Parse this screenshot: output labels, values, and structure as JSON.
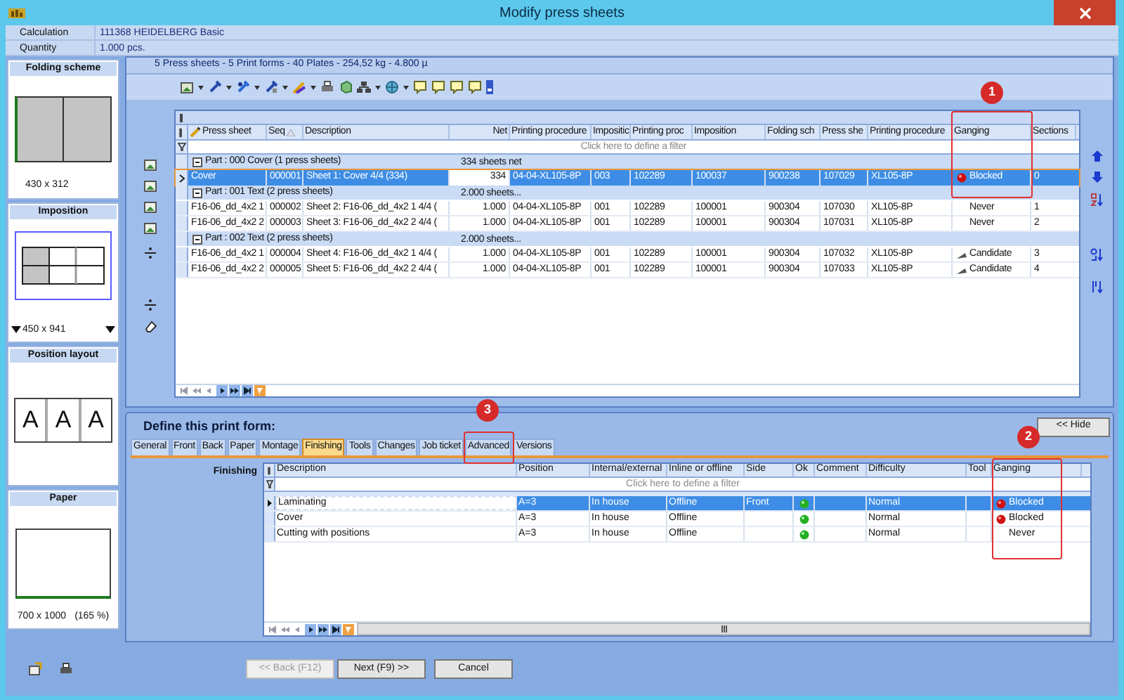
{
  "window": {
    "title": "Modify press sheets"
  },
  "header": [
    {
      "label": "Calculation",
      "value": "111368 HEIDELBERG Basic"
    },
    {
      "label": "Quantity",
      "value": "1.000 pcs."
    }
  ],
  "side_panels": [
    {
      "kind": "folding",
      "title": "Folding scheme",
      "caption": "430 x 312"
    },
    {
      "kind": "imposition",
      "title": "Imposition",
      "caption": "450 x 941"
    },
    {
      "kind": "positions",
      "title": "Position layout",
      "letters": [
        "A",
        "A",
        "A"
      ]
    },
    {
      "kind": "paper",
      "title": "Paper",
      "caption": "700 x 1000",
      "zoom": "(165 %)"
    }
  ],
  "summary": "5 Press sheets - 5 Print forms - 40 Plates - 254,52 kg - 4.800 µ",
  "press_sheets": {
    "columns": [
      "Press sheet",
      "Seq",
      "Description",
      "Net",
      "Printing procedure",
      "Impositic",
      "Printing proc",
      "Imposition",
      "Folding sch",
      "Press she",
      "Printing procedure",
      "Ganging",
      "Sections"
    ],
    "filter_placeholder": "Click here to define a filter",
    "groups": [
      {
        "title": "Part : 000 Cover (1 press sheets)",
        "total": "334 sheets net",
        "rows": [
          {
            "selected": true,
            "cells": [
              "Cover",
              "000001",
              "Sheet 1: Cover 4/4 (334)",
              "334",
              "04-04-XL105-8P",
              "003",
              "102289",
              "100037",
              "900238",
              "107029",
              "XL105-8P"
            ],
            "ganging": {
              "kind": "blocked",
              "label": "Blocked"
            },
            "sections": "0"
          }
        ]
      },
      {
        "title": "Part : 001 Text (2 press sheets)",
        "total": "2.000 sheets...",
        "rows": [
          {
            "selected": false,
            "cells": [
              "F16-06_dd_4x2 1",
              "000002",
              "Sheet 2: F16-06_dd_4x2 1 4/4 (",
              "1.000",
              "04-04-XL105-8P",
              "001",
              "102289",
              "100001",
              "900304",
              "107030",
              "XL105-8P"
            ],
            "ganging": {
              "kind": "never",
              "label": "Never"
            },
            "sections": "1"
          },
          {
            "selected": false,
            "cells": [
              "F16-06_dd_4x2 2",
              "000003",
              "Sheet 3: F16-06_dd_4x2 2 4/4 (",
              "1.000",
              "04-04-XL105-8P",
              "001",
              "102289",
              "100001",
              "900304",
              "107031",
              "XL105-8P"
            ],
            "ganging": {
              "kind": "never",
              "label": "Never"
            },
            "sections": "2"
          }
        ]
      },
      {
        "title": "Part : 002 Text (2 press sheets)",
        "total": "2.000 sheets...",
        "rows": [
          {
            "selected": false,
            "cells": [
              "F16-06_dd_4x2 1",
              "000004",
              "Sheet 4: F16-06_dd_4x2 1 4/4 (",
              "1.000",
              "04-04-XL105-8P",
              "001",
              "102289",
              "100001",
              "900304",
              "107032",
              "XL105-8P"
            ],
            "ganging": {
              "kind": "candidate",
              "label": "Candidate"
            },
            "sections": "3"
          },
          {
            "selected": false,
            "cells": [
              "F16-06_dd_4x2 2",
              "000005",
              "Sheet 5: F16-06_dd_4x2 2 4/4 (",
              "1.000",
              "04-04-XL105-8P",
              "001",
              "102289",
              "100001",
              "900304",
              "107033",
              "XL105-8P"
            ],
            "ganging": {
              "kind": "candidate",
              "label": "Candidate"
            },
            "sections": "4"
          }
        ]
      }
    ]
  },
  "print_form": {
    "title": "Define this print form:",
    "hide_button": "<< Hide",
    "tabs": [
      {
        "label": "General",
        "selected": false
      },
      {
        "label": "Front",
        "selected": false
      },
      {
        "label": "Back",
        "selected": false
      },
      {
        "label": "Paper",
        "selected": false
      },
      {
        "label": "Montage",
        "selected": false
      },
      {
        "label": "Finishing",
        "selected": true
      },
      {
        "label": "Tools",
        "selected": false
      },
      {
        "label": "Changes",
        "selected": false
      },
      {
        "label": "Job ticket",
        "selected": false
      },
      {
        "label": "Advanced",
        "selected": false
      },
      {
        "label": "Versions",
        "selected": false
      }
    ],
    "section_label": "Finishing",
    "columns": [
      "Description",
      "Position",
      "Internal/external",
      "Inline or offline",
      "Side",
      "Ok",
      "Comment",
      "Difficulty",
      "Tool",
      "Ganging"
    ],
    "filter_placeholder": "Click here to define a filter",
    "rows": [
      {
        "selected": true,
        "description": "Laminating",
        "position": "A=3",
        "internal_external": "In house",
        "inline_offline": "Offline",
        "side": "Front",
        "ok": true,
        "difficulty": "Normal",
        "ganging": {
          "kind": "blocked",
          "label": "Blocked"
        }
      },
      {
        "selected": false,
        "description": "Cover",
        "position": "A=3",
        "internal_external": "In house",
        "inline_offline": "Offline",
        "ok": true,
        "difficulty": "Normal",
        "ganging": {
          "kind": "blocked",
          "label": "Blocked"
        }
      },
      {
        "selected": false,
        "description": "Cutting with positions",
        "position": "A=3",
        "internal_external": "In house",
        "inline_offline": "Offline",
        "ok": true,
        "difficulty": "Normal",
        "ganging": {
          "kind": "never",
          "label": "Never"
        }
      }
    ]
  },
  "buttons": [
    {
      "label": "<< Back (F12)",
      "disabled": true
    },
    {
      "label": "Next (F9) >>",
      "disabled": false
    },
    {
      "label": "Cancel",
      "disabled": false
    }
  ],
  "annotations": [
    {
      "label": "1"
    },
    {
      "label": "2"
    },
    {
      "label": "3"
    }
  ]
}
